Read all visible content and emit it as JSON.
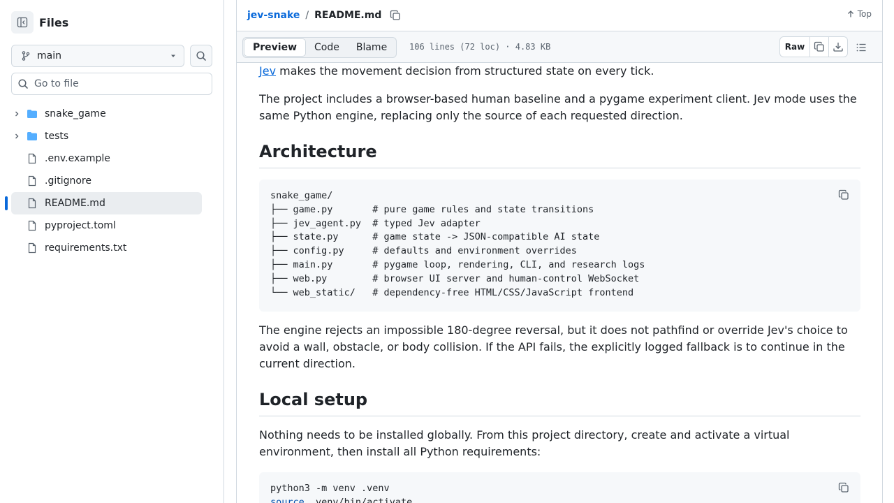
{
  "sidebar": {
    "title": "Files",
    "branch": "main",
    "search_placeholder": "Go to file",
    "tree": [
      {
        "name": "snake_game",
        "type": "folder"
      },
      {
        "name": "tests",
        "type": "folder"
      },
      {
        "name": ".env.example",
        "type": "file"
      },
      {
        "name": ".gitignore",
        "type": "file"
      },
      {
        "name": "README.md",
        "type": "file",
        "selected": true
      },
      {
        "name": "pyproject.toml",
        "type": "file"
      },
      {
        "name": "requirements.txt",
        "type": "file"
      }
    ]
  },
  "header": {
    "repo": "jev-snake",
    "separator": "/",
    "file": "README.md",
    "top_label": "Top"
  },
  "toolbar": {
    "tabs": [
      "Preview",
      "Code",
      "Blame"
    ],
    "active_tab": "Preview",
    "file_meta": "106 lines (72 loc) · 4.83 KB",
    "raw_label": "Raw"
  },
  "readme": {
    "intro_link": "Jev",
    "intro_rest": " makes the movement decision from structured state on every tick.",
    "para1": "The project includes a browser-based human baseline and a pygame experiment client. Jev mode uses the same Python engine, replacing only the source of each requested direction.",
    "h_architecture": "Architecture",
    "code_architecture": "snake_game/\n├── game.py       # pure game rules and state transitions\n├── jev_agent.py  # typed Jev adapter\n├── state.py      # game state -> JSON-compatible AI state\n├── config.py     # defaults and environment overrides\n├── main.py       # pygame loop, rendering, CLI, and research logs\n├── web.py        # browser UI server and human-control WebSocket\n└── web_static/   # dependency-free HTML/CSS/JavaScript frontend",
    "para2": "The engine rejects an impossible 180-degree reversal, but it does not pathfind or override Jev's choice to avoid a wall, obstacle, or body collision. If the API fails, the explicitly logged fallback is to continue in the current direction.",
    "h_local_setup": "Local setup",
    "para3": "Nothing needs to be installed globally. From this project directory, create and activate a virtual environment, then install all Python requirements:",
    "code_setup_line1": "python3 -m venv .venv",
    "code_setup_kw": "source",
    "code_setup_line2_rest": " .venv/bin/activate"
  },
  "colors": {
    "accent": "#0969da",
    "border": "#d1d9e0",
    "code_bg": "#f6f8fa",
    "folder": "#54aeff"
  },
  "icons": {
    "sidebar_toggle": "sidebar-collapse-icon",
    "branch": "git-branch-icon",
    "search": "search-icon",
    "copy": "copy-icon",
    "download": "download-icon",
    "outline": "list-unordered-icon",
    "top": "arrow-up-icon"
  }
}
